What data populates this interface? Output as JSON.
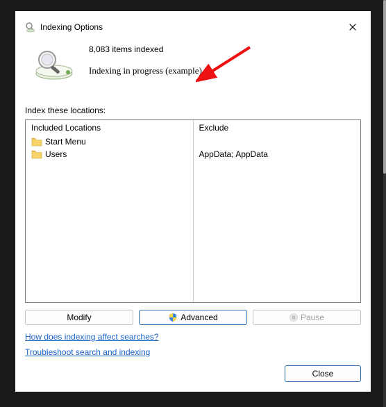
{
  "title": "Indexing Options",
  "count_line": "8,083 items indexed",
  "status_line": "Indexing in progress (example)",
  "section_label": "Index these locations:",
  "col_included": "Included Locations",
  "col_exclude": "Exclude",
  "locations": [
    {
      "label": "Start Menu",
      "exclude": ""
    },
    {
      "label": "Users",
      "exclude": "AppData; AppData"
    }
  ],
  "buttons": {
    "modify": "Modify",
    "advanced": "Advanced",
    "pause": "Pause"
  },
  "links": {
    "affect": "How does indexing affect searches?",
    "troubleshoot": "Troubleshoot search and indexing"
  },
  "close_label": "Close"
}
